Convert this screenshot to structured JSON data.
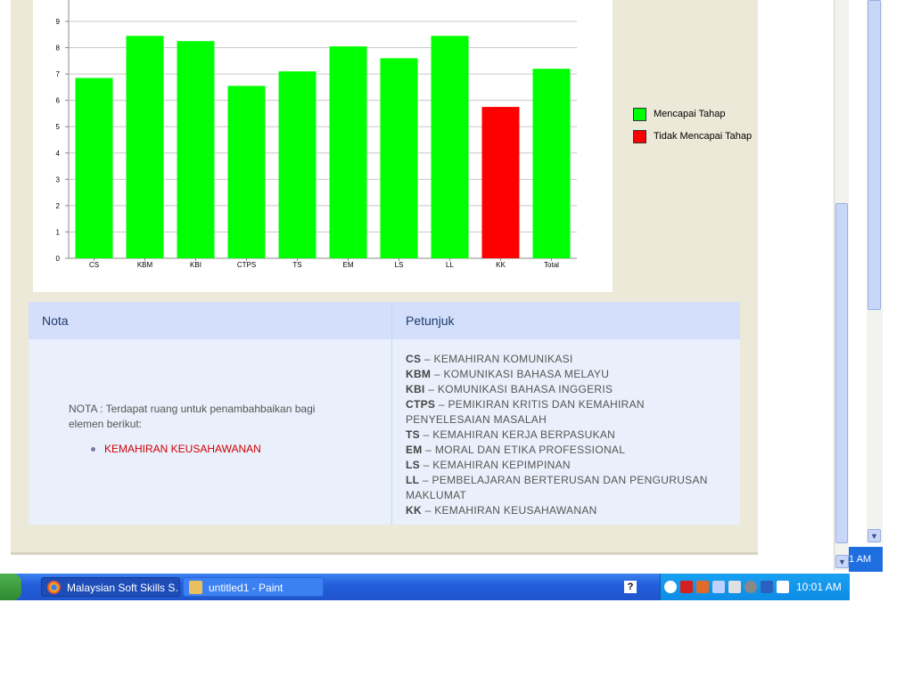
{
  "chart_data": {
    "type": "bar",
    "categories": [
      "CS",
      "KBM",
      "KBI",
      "CTPS",
      "TS",
      "EM",
      "LS",
      "LL",
      "KK",
      "Total"
    ],
    "values": [
      6.85,
      8.45,
      8.25,
      6.55,
      7.1,
      8.05,
      7.6,
      8.45,
      5.75,
      7.2
    ],
    "status": [
      "Mencapai Tahap",
      "Mencapai Tahap",
      "Mencapai Tahap",
      "Mencapai Tahap",
      "Mencapai Tahap",
      "Mencapai Tahap",
      "Mencapai Tahap",
      "Mencapai Tahap",
      "Tidak Mencapai Tahap",
      "Mencapai Tahap"
    ],
    "yticks": [
      "0",
      "1",
      "2",
      "3",
      "4",
      "5",
      "6",
      "7",
      "8",
      "9"
    ],
    "ylim": [
      0,
      9.5
    ],
    "grid": true,
    "legend": [
      {
        "name": "Mencapai Tahap",
        "color": "#00ff00"
      },
      {
        "name": "Tidak Mencapai Tahap",
        "color": "#ff0000"
      }
    ],
    "legend_position": "right"
  },
  "nota": {
    "header": "Nota",
    "text": "NOTA : Terdapat ruang untuk penambahbaikan bagi elemen berikut:",
    "items": [
      "KEMAHIRAN KEUSAHAWANAN"
    ]
  },
  "petunjuk": {
    "header": "Petunjuk",
    "entries": [
      {
        "code": "CS",
        "desc": "KEMAHIRAN KOMUNIKASI"
      },
      {
        "code": "KBM",
        "desc": "KOMUNIKASI BAHASA MELAYU"
      },
      {
        "code": "KBI",
        "desc": "KOMUNIKASI BAHASA INGGERIS"
      },
      {
        "code": "CTPS",
        "desc": "PEMIKIRAN KRITIS DAN KEMAHIRAN PENYELESAIAN MASALAH"
      },
      {
        "code": "TS",
        "desc": "KEMAHIRAN KERJA BERPASUKAN"
      },
      {
        "code": "EM",
        "desc": "MORAL DAN ETIKA PROFESSIONAL"
      },
      {
        "code": "LS",
        "desc": "KEMAHIRAN KEPIMPINAN"
      },
      {
        "code": "LL",
        "desc": "PEMBELAJARAN BERTERUSAN DAN PENGURUSAN MAKLUMAT"
      },
      {
        "code": "KK",
        "desc": "KEMAHIRAN KEUSAHAWANAN"
      }
    ]
  },
  "taskbar": {
    "buttons": [
      {
        "label": "Malaysian Soft Skills S...",
        "icon": "chrome-icon",
        "active": true
      },
      {
        "label": "untitled1 - Paint",
        "icon": "paint-icon",
        "active": false
      }
    ],
    "clock": "10:01 AM",
    "side_clock_fragment": "1 AM"
  },
  "colors": {
    "pass": "#00ff00",
    "fail": "#ff0000",
    "header_bg": "#d4e0fb",
    "cell_bg": "#eaf0fb"
  }
}
